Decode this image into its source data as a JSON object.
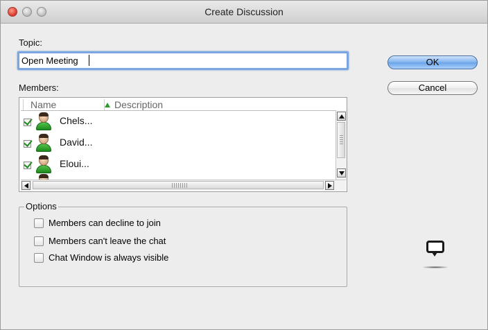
{
  "window": {
    "title": "Create Discussion"
  },
  "topic": {
    "label": "Topic:",
    "value": "Open Meeting"
  },
  "buttons": {
    "ok": "OK",
    "cancel": "Cancel"
  },
  "members": {
    "label": "Members:",
    "columns": [
      "Name",
      "Description"
    ],
    "rows": [
      {
        "name": "Chels...",
        "description": "",
        "checked": true
      },
      {
        "name": "David...",
        "description": "",
        "checked": true
      },
      {
        "name": "Eloui...",
        "description": "",
        "checked": true
      }
    ]
  },
  "options": {
    "legend": "Options",
    "items": [
      {
        "label": "Members can decline to join",
        "checked": false
      },
      {
        "label": "Members can't leave the chat",
        "checked": false
      },
      {
        "label": "Chat Window is always visible",
        "checked": false
      }
    ]
  },
  "icons": {
    "chat": "chat-bubble-icon"
  },
  "colors": {
    "focus_ring": "#7aa7e0",
    "default_button": "#7fb2ee",
    "check": "#1f8a1f"
  }
}
